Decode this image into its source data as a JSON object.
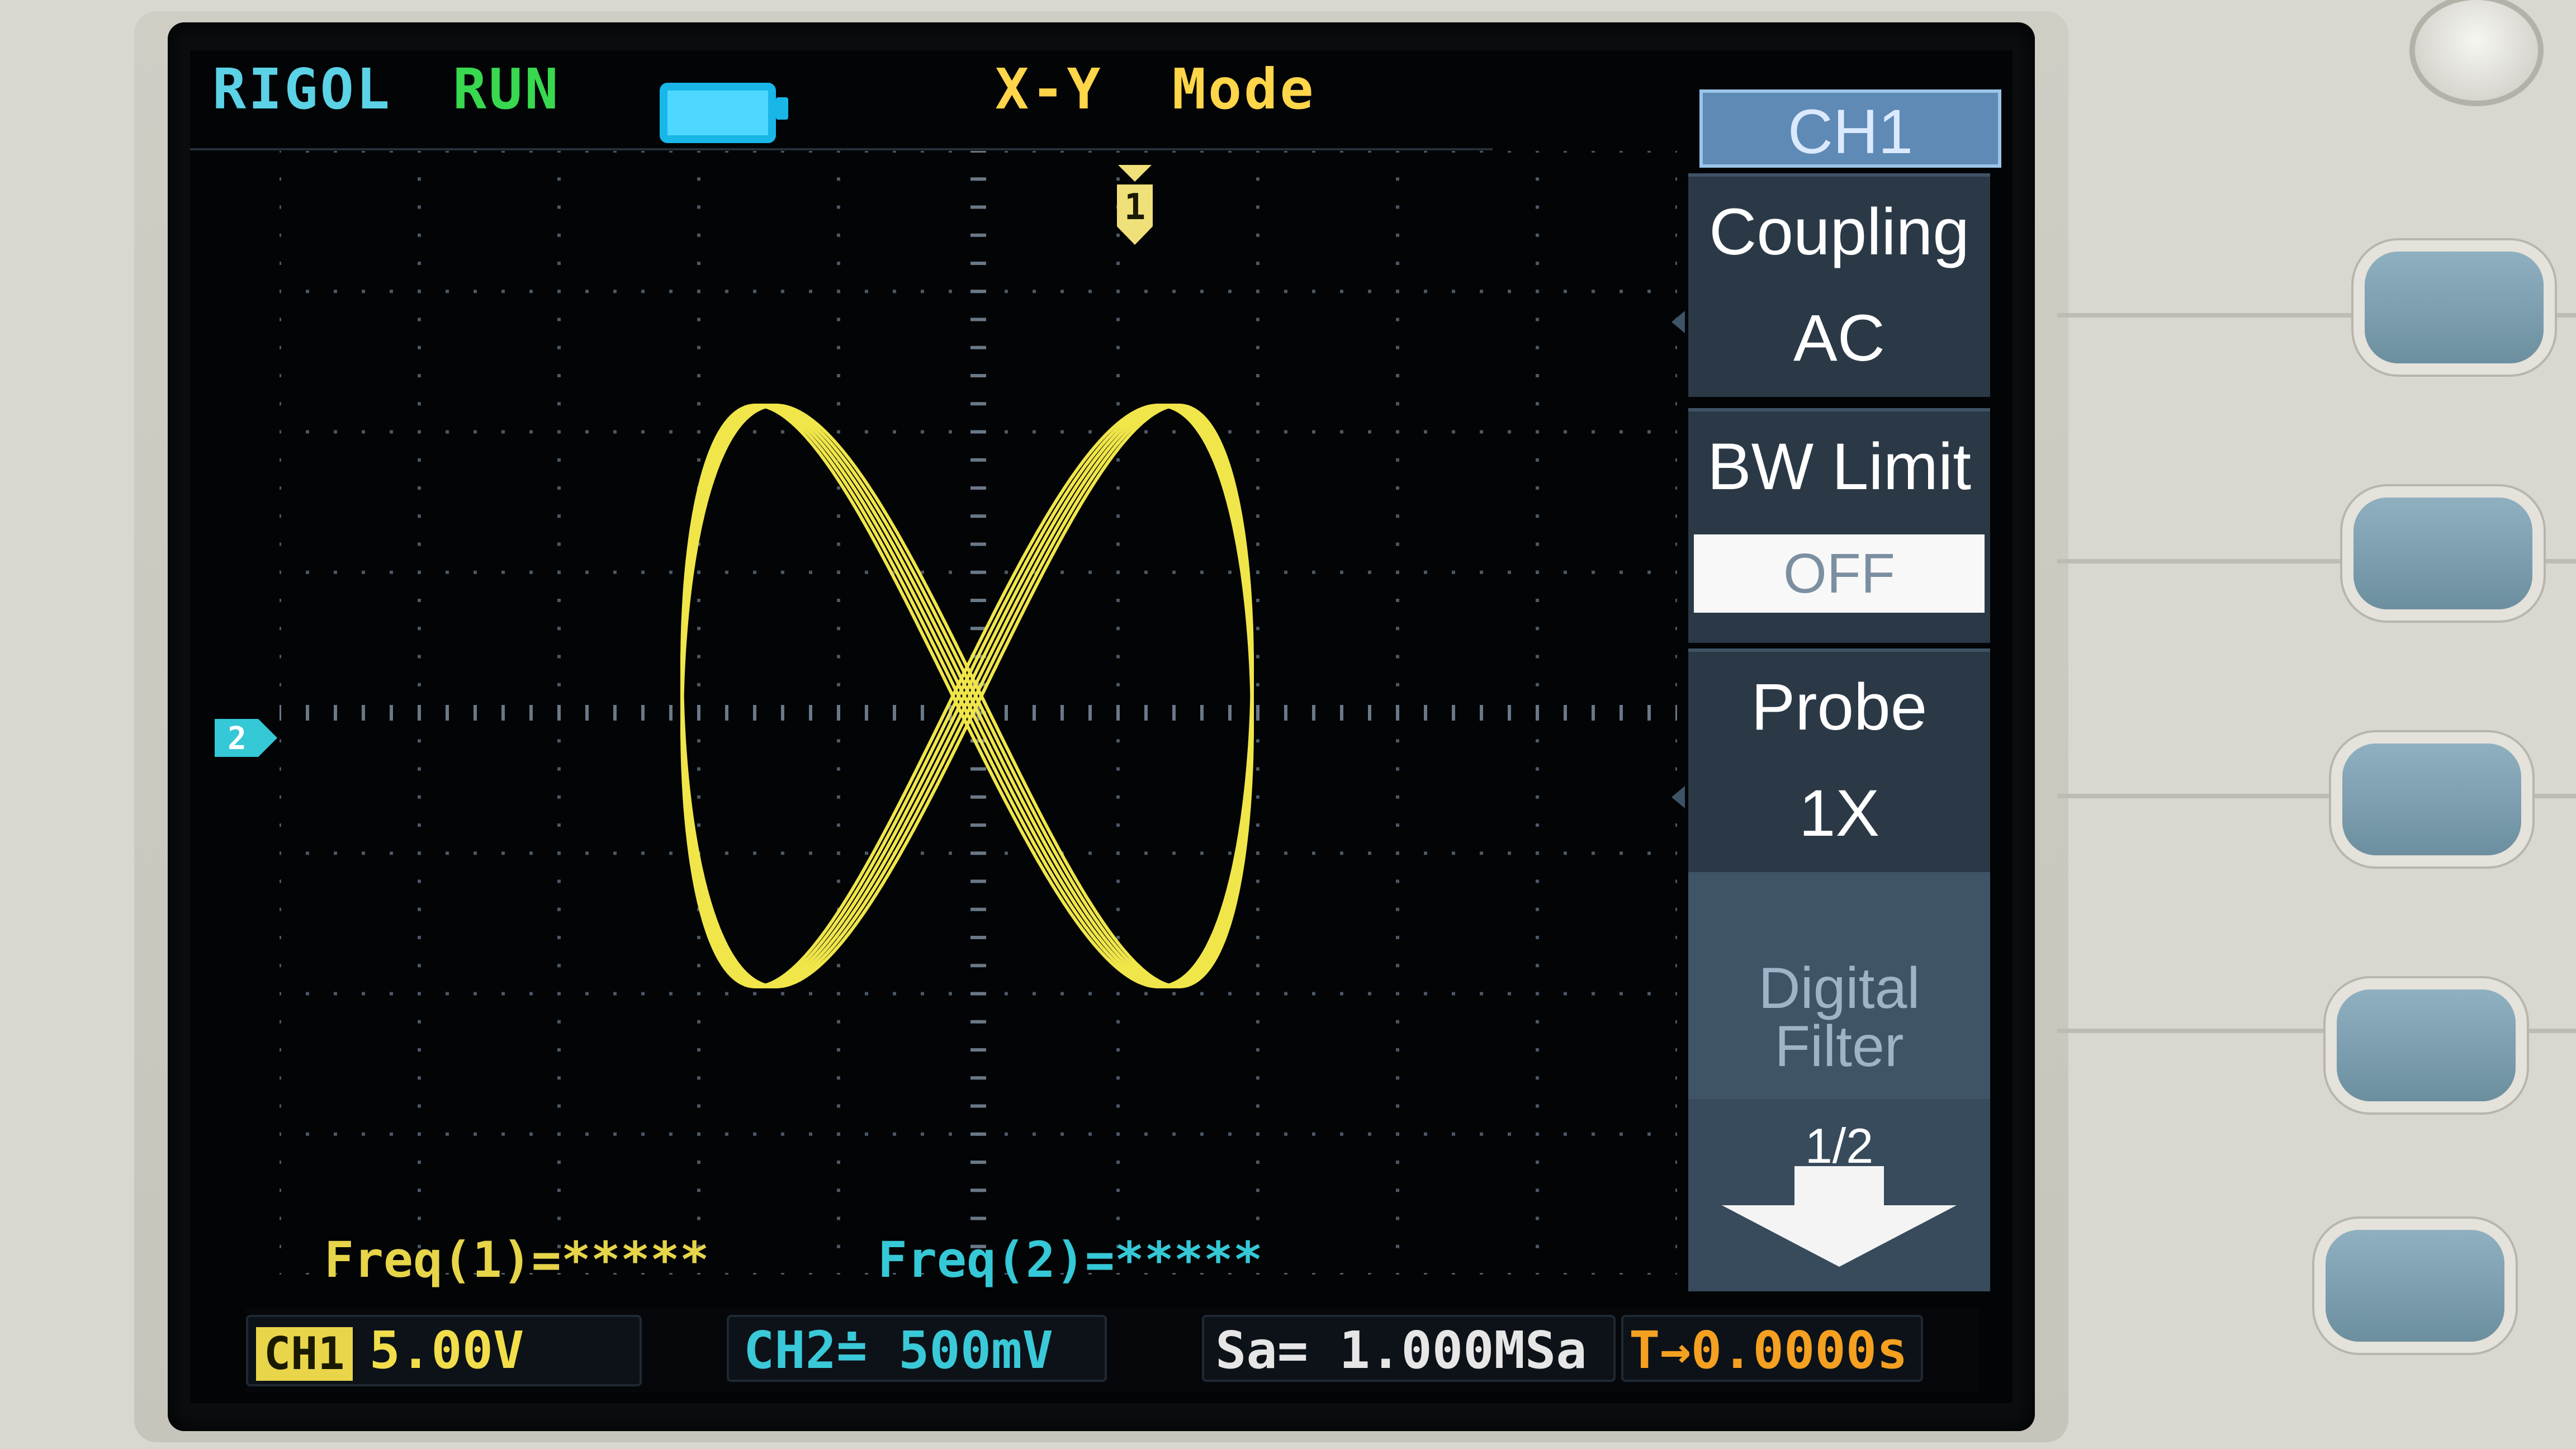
{
  "header": {
    "brand": "RIGOL",
    "run_status": "RUN",
    "mode": "X-Y   Mode"
  },
  "markers": {
    "ch1": "1",
    "ch2": "2"
  },
  "measurements": {
    "freq1": "Freq(1)=*****",
    "freq2": "Freq(2)=*****"
  },
  "status_bar": {
    "ch1_tag": "CH1",
    "ch1_scale": "5.00V",
    "ch2_scale": "CH2≐ 500mV",
    "sample_rate": "Sa= 1.000MSa",
    "trigger_offset": "T→0.0000s"
  },
  "menu": {
    "title": "CH1",
    "coupling_label": "Coupling",
    "coupling_value": "AC",
    "bw_limit_label": "BW Limit",
    "bw_limit_value": "OFF",
    "probe_label": "Probe",
    "probe_value": "1X",
    "digital_filter_label": "Digital Filter",
    "page_label": "1/2"
  },
  "colors": {
    "ch1_trace": "#f0e64a",
    "ch2_accent": "#35c8d6",
    "brand": "#5bd2e6",
    "run": "#38d84f"
  },
  "icons": [
    "battery-icon",
    "ch1-position-marker-icon",
    "ch2-position-marker-icon",
    "page-down-arrow-icon"
  ]
}
